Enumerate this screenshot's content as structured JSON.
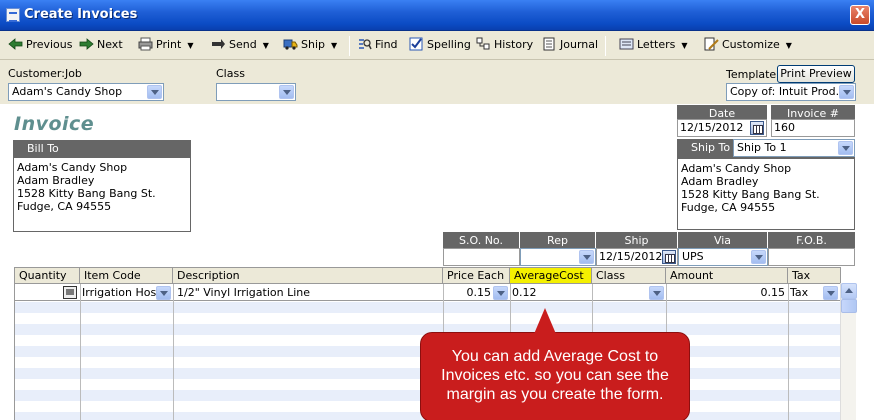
{
  "window": {
    "title": "Create Invoices",
    "close_label": "X"
  },
  "toolbar": {
    "previous": "Previous",
    "next": "Next",
    "print": "Print",
    "send": "Send",
    "ship": "Ship",
    "find": "Find",
    "spelling": "Spelling",
    "history": "History",
    "journal": "Journal",
    "letters": "Letters",
    "customize": "Customize"
  },
  "header": {
    "customer_label": "Customer:Job",
    "customer_value": "Adam's Candy Shop",
    "class_label": "Class",
    "class_value": "",
    "template_label": "Template",
    "print_preview": "Print Preview",
    "template_value": "Copy of: Intuit Prod..."
  },
  "invoice": {
    "title": "Invoice",
    "date_label": "Date",
    "date_value": "12/15/2012",
    "invoice_no_label": "Invoice #",
    "invoice_no_value": "160",
    "bill_to_label": "Bill To",
    "bill_to": [
      "Adam's Candy Shop",
      "Adam Bradley",
      "1528 Kitty Bang Bang St.",
      "Fudge, CA 94555"
    ],
    "ship_to_label": "Ship To",
    "ship_to_select": "Ship To 1",
    "ship_to": [
      "Adam's Candy Shop",
      "Adam Bradley",
      "1528 Kitty Bang Bang St.",
      "Fudge, CA 94555"
    ],
    "so_label": "S.O. No.",
    "so_value": "",
    "rep_label": "Rep",
    "rep_value": "",
    "ship_label": "Ship",
    "ship_value": "12/15/2012",
    "via_label": "Via",
    "via_value": "UPS",
    "fob_label": "F.O.B.",
    "fob_value": ""
  },
  "lines": {
    "columns": [
      "Quantity",
      "Item Code",
      "Description",
      "Price Each",
      "AverageCost",
      "Class",
      "Amount",
      "Tax"
    ],
    "rows": [
      {
        "quantity": "",
        "item": "Irrigation Hose",
        "description": "1/2\"  Vinyl Irrigation Line",
        "price": "0.15",
        "avg_cost": "0.12",
        "class": "",
        "amount": "0.15",
        "tax": "Tax"
      }
    ]
  },
  "callout": {
    "line1": "You can add Average Cost to",
    "line2": "Invoices etc. so you can see the",
    "line3": "margin as you create the form."
  },
  "colors": {
    "titlebar": "#0b4bc4",
    "highlight": "#f4f000",
    "callout": "#c91d1d",
    "invoice_title": "#5f8f8f"
  }
}
